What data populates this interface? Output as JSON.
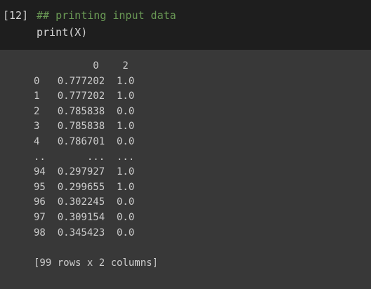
{
  "cell": {
    "execution_count": "[12]",
    "code_lines": [
      "## printing input data",
      "print(X)"
    ]
  },
  "output": {
    "lines": [
      "          0    2",
      "0   0.777202  1.0",
      "1   0.777202  1.0",
      "2   0.785838  0.0",
      "3   0.785838  1.0",
      "4   0.786701  0.0",
      "..       ...  ...",
      "94  0.297927  1.0",
      "95  0.299655  1.0",
      "96  0.302245  0.0",
      "97  0.309154  0.0",
      "98  0.345423  0.0",
      "",
      "[99 rows x 2 columns]"
    ]
  },
  "colors": {
    "input_background": "#1e1e1e",
    "output_background": "#383838",
    "comment": "#6a9955",
    "code_text": "#d4d4d4",
    "output_text": "#cccccc"
  }
}
